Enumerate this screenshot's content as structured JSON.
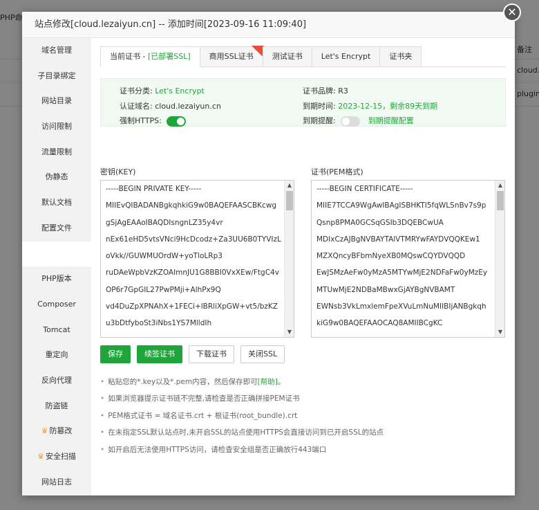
{
  "background": {
    "left_label": "PHP命",
    "right_header": "备注",
    "right_row1": "cloud.le",
    "right_row2": "plugin.l"
  },
  "modal": {
    "title": "站点修改[cloud.lezaiyun.cn] -- 添加时间[2023-09-16 11:09:40]",
    "close_glyph": "✕"
  },
  "sidebar": {
    "items": [
      {
        "label": "域名管理"
      },
      {
        "label": "子目录绑定"
      },
      {
        "label": "网站目录"
      },
      {
        "label": "访问限制"
      },
      {
        "label": "流量限制"
      },
      {
        "label": "伪静态"
      },
      {
        "label": "默认文档"
      },
      {
        "label": "配置文件"
      },
      {
        "label": "SSL"
      },
      {
        "label": "PHP版本"
      },
      {
        "label": "Composer"
      },
      {
        "label": "Tomcat"
      },
      {
        "label": "重定向"
      },
      {
        "label": "反向代理"
      },
      {
        "label": "防盗链"
      },
      {
        "label": "防篡改",
        "vip": true
      },
      {
        "label": "安全扫描",
        "vip": true
      },
      {
        "label": "网站日志"
      }
    ],
    "vip_glyph": "♛"
  },
  "tabs": {
    "current_prefix": "当前证书 - ",
    "current_status": "[已部署SSL]",
    "commercial": "商用SSL证书",
    "ribbon": "推荐",
    "test": "测试证书",
    "letsencrypt": "Let's Encrypt",
    "folder": "证书夹"
  },
  "info": {
    "category_label": "证书分类:",
    "category_value": "Let's Encrypt",
    "domain_label": "认证域名:",
    "domain_value": "cloud.lezaiyun.cn",
    "https_label": "强制HTTPS:",
    "https_on": true,
    "brand_label": "证书品牌:",
    "brand_value": "R3",
    "expire_label": "到期时间:",
    "expire_value": "2023-12-15，剩余89天到期",
    "remind_label": "到期提醒:",
    "remind_on": false,
    "remind_link": "到期提醒配置"
  },
  "key_pane": {
    "label": "密钥(KEY)",
    "lines": [
      "-----BEGIN PRIVATE KEY-----",
      "MIIEvQIBADANBgkqhkiG9w0BAQEFAASCBKcwg",
      "gSjAgEAAoIBAQDIsngnLZ35y4vr",
      "nEx61eHD5vtsVNci9HcDcodz+Za3UU6B0TYVIzL",
      "oVkk//GUWMUOrdW+yoTloLRp3",
      "ruDAeWpbVzKZOAImnJU1G8BBI0VxXEw/FtgC4v",
      "OP6r7GpGIL27PwPMji+AlhPx9Q",
      "vd4DuZpXPNAhX+1FECi+lBRliXpGW+vt5/bzKZ",
      "u3bDtfyboSt3iNbs1YS7MlldIh",
      "ojNvU8Jdr3HsN8kuwDdr0nPn07O04YX+n5gv88"
    ]
  },
  "cert_pane": {
    "label": "证书(PEM格式)",
    "lines": [
      "-----BEGIN CERTIFICATE-----",
      "MIIE7TCCA9WgAwIBAgISBHKTI5fqWLSnBv7s9p",
      "Qsnp8PMA0GCSqGSIb3DQEBCwUA",
      "MDIxCzAJBgNVBAYTAlVTMRYwFAYDVQQKEw1",
      "MZXQncyBFbmNyeXB0MQswCQYDVQQD",
      "EwJSMzAeFw0yMzA5MTYwMjE2NDFaFw0yMzEy",
      "MTUwMjE2NDBaMBwxGjAYBgNVBAMT",
      "EWNsb3VkLmxlemFpeXVuLmNuMIIBIjANBgkqh",
      "kiG9w0BAQEFAAOCAQ8AMIIBCgKC",
      "AQEAyLJ4Jy2d+cuL65xMetXhw+b7bFTXIvR3A3"
    ]
  },
  "buttons": {
    "save": "保存",
    "renew": "续签证书",
    "download": "下载证书",
    "close_ssl": "关闭SSL"
  },
  "tips": {
    "tip1_text": "粘贴您的*.key以及*.pem内容，然后保存即可",
    "tip1_link": "[帮助]",
    "tip1_end": "。",
    "tip2": "如果浏览器提示证书链不完整,请检查是否正确拼接PEM证书",
    "tip3": "PEM格式证书 = 域名证书.crt + 根证书(root_bundle).crt",
    "tip4": "在未指定SSL默认站点时,未开启SSL的站点使用HTTPS会直接访问到已开启SSL的站点",
    "tip5": "如开启后无法使用HTTPS访问，请检查安全组是否正确放行443端口"
  },
  "colors": {
    "accent_green": "#20a53a",
    "info_bg": "#f1f9f3",
    "ribbon_red": "#e74c3c"
  }
}
